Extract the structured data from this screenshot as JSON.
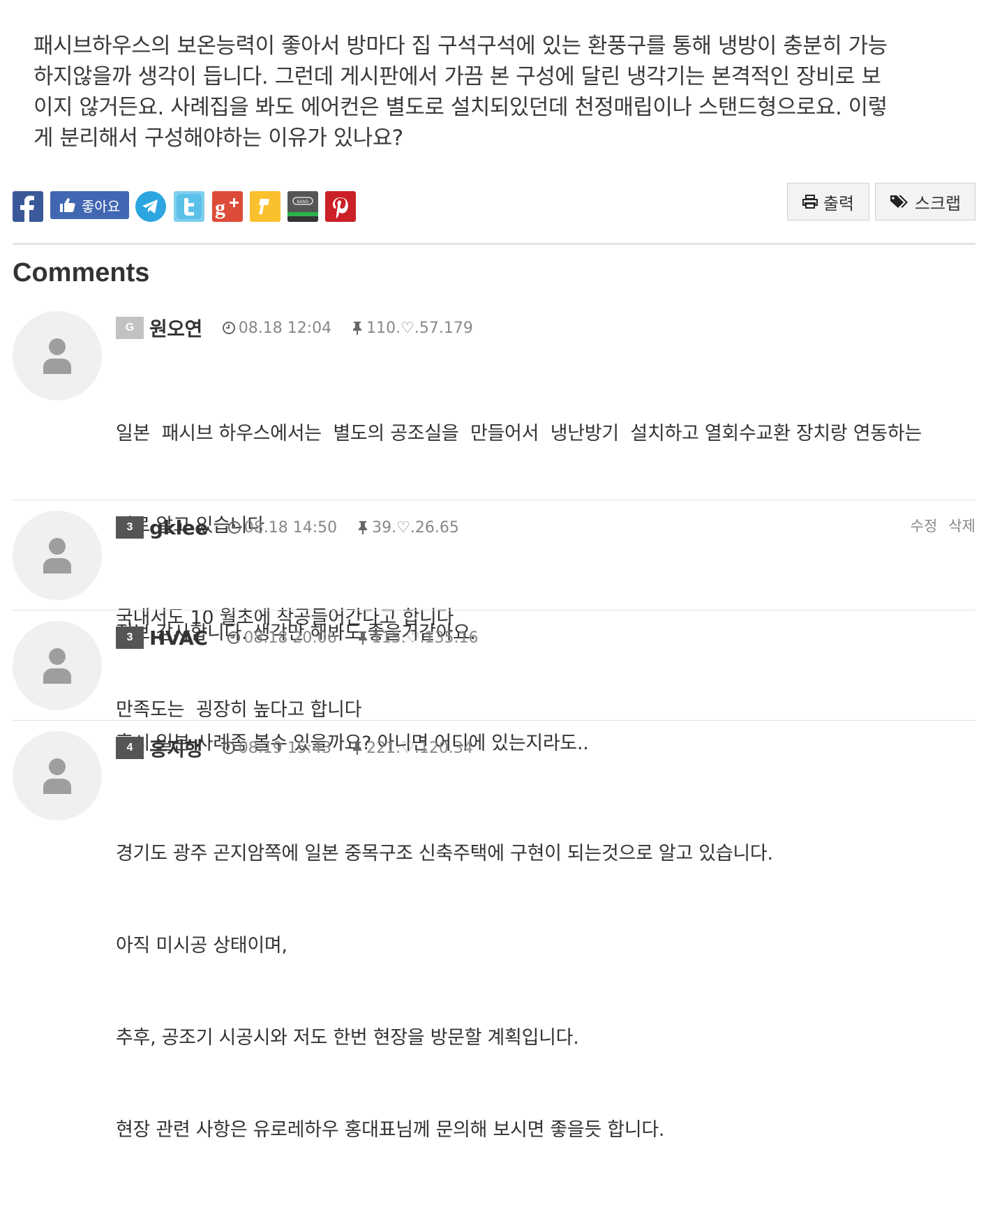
{
  "post": {
    "lines": [
      "패시브하우스의 보온능력이 좋아서 방마다 집 구석구석에 있는 환풍구를 통해 냉방이 충분히 가능",
      "하지않을까 생각이 듭니다. 그런데 게시판에서 가끔 본 구성에 달린 냉각기는 본격적인 장비로 보",
      "이지 않거든요. 사례집을 봐도 에어컨은 별도로 설치되있던데 천정매립이나 스탠드형으로요. 이렇",
      "게 분리해서 구성해야하는 이유가 있나요?"
    ]
  },
  "share": {
    "like_label": "좋아요",
    "icons": [
      "facebook-icon",
      "facebook-like-icon",
      "telegram-icon",
      "twitter-icon",
      "google-plus-icon",
      "kakaostory-icon",
      "band-icon",
      "pinterest-icon"
    ],
    "band_text": "BAND"
  },
  "tools": {
    "print_label": "출력",
    "scrap_label": "스크랩"
  },
  "comments_title": "Comments",
  "comments": [
    {
      "level": "G",
      "nick": "원오연",
      "date": "08.18 12:04",
      "ip": "110.♡.57.179",
      "lines": [
        "일본  패시브 하우스에서는  별도의 공조실을  만들어서  냉난방기  설치하고 열회수교환 장치랑 연동하는",
        "걸로 알고 있습니다",
        "국내서도 10 월초에 착공들어간다고 합니다",
        "만족도는  굉장히 높다고 합니다"
      ]
    },
    {
      "level": "3",
      "nick": "gklee",
      "date": "08.18 14:50",
      "ip": "39.♡.26.65",
      "edit_label": "수정",
      "delete_label": "삭제",
      "lines": [
        "정보 감사합니다. 생각만 해봐도 좋을거같아요."
      ]
    },
    {
      "level": "3",
      "nick": "HVAC",
      "date": "08.18 20:06",
      "ip": "115.♡.135.16",
      "lines": [
        "혹시 일본 사례좀 볼수 있을까요? 아니면 어디에 있는지라도.."
      ]
    },
    {
      "level": "4",
      "nick": "홍지행",
      "date": "08.19 15:43",
      "ip": "221.♡.120.34",
      "lines": [
        "경기도 광주 곤지암쪽에 일본 중목구조 신축주택에 구현이 되는것으로 알고 있습니다.",
        "아직 미시공 상태이며,",
        "추후, 공조기 시공시와 저도 한번 현장을 방문할 계획입니다.",
        "현장 관련 사항은 유로레하우 홍대표님께 문의해 보시면 좋을듯 합니다."
      ]
    }
  ]
}
